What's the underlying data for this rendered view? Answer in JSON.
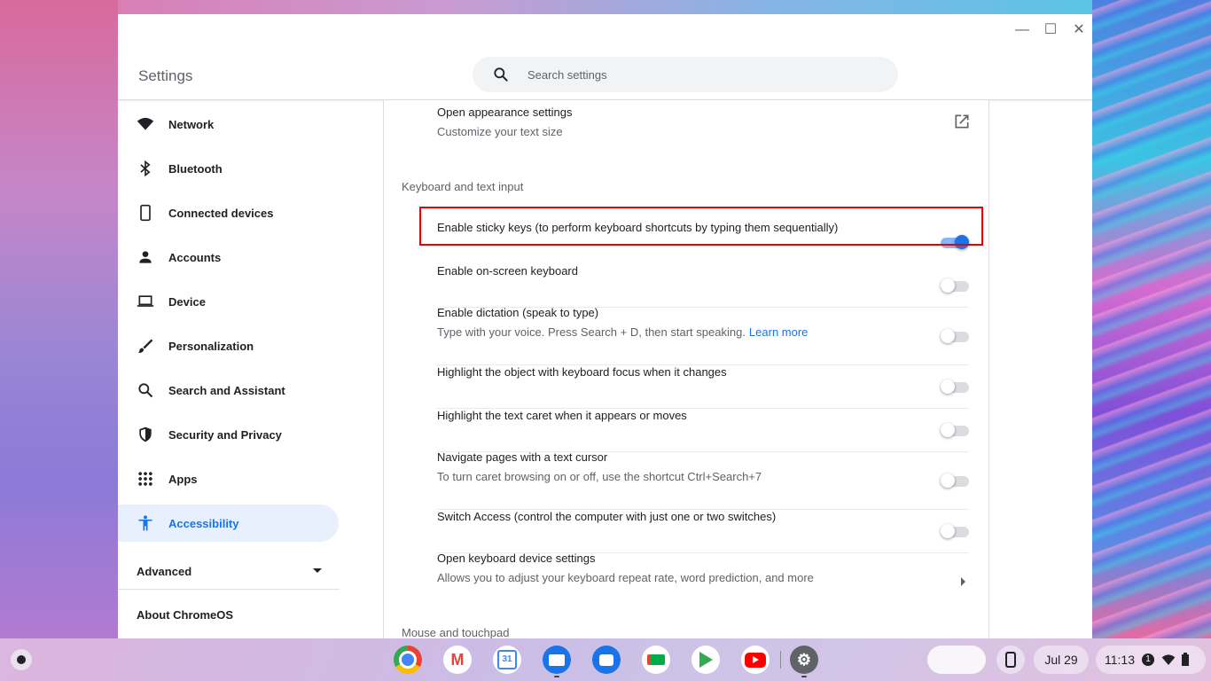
{
  "window": {
    "app_title": "Settings",
    "controls": {
      "minimize": "—",
      "maximize": "☐",
      "close": "✕"
    }
  },
  "search": {
    "placeholder": "Search settings"
  },
  "sidebar": {
    "items": [
      {
        "label": "Network",
        "icon": "wifi-icon"
      },
      {
        "label": "Bluetooth",
        "icon": "bluetooth-icon"
      },
      {
        "label": "Connected devices",
        "icon": "phone-icon"
      },
      {
        "label": "Accounts",
        "icon": "person-icon"
      },
      {
        "label": "Device",
        "icon": "laptop-icon"
      },
      {
        "label": "Personalization",
        "icon": "brush-icon"
      },
      {
        "label": "Search and Assistant",
        "icon": "search-icon"
      },
      {
        "label": "Security and Privacy",
        "icon": "shield-icon"
      },
      {
        "label": "Apps",
        "icon": "apps-grid-icon"
      },
      {
        "label": "Accessibility",
        "icon": "accessibility-icon",
        "active": true
      }
    ],
    "advanced_label": "Advanced",
    "about_label": "About ChromeOS"
  },
  "content": {
    "appearance": {
      "title": "Open appearance settings",
      "subtitle": "Customize your text size"
    },
    "keyboard_section_title": "Keyboard and text input",
    "keyboard_rows": [
      {
        "title": "Enable sticky keys (to perform keyboard shortcuts by typing them sequentially)",
        "subtitle": "",
        "enabled": true
      },
      {
        "title": "Enable on-screen keyboard",
        "subtitle": "",
        "enabled": false
      },
      {
        "title": "Enable dictation (speak to type)",
        "subtitle": "Type with your voice. Press Search + D, then start speaking.",
        "link": "Learn more",
        "enabled": false
      },
      {
        "title": "Highlight the object with keyboard focus when it changes",
        "subtitle": "",
        "enabled": false
      },
      {
        "title": "Highlight the text caret when it appears or moves",
        "subtitle": "",
        "enabled": false
      },
      {
        "title": "Navigate pages with a text cursor",
        "subtitle": "To turn caret browsing on or off, use the shortcut Ctrl+Search+7",
        "enabled": false
      },
      {
        "title": "Switch Access (control the computer with just one or two switches)",
        "subtitle": "",
        "enabled": false
      }
    ],
    "keyboard_device": {
      "title": "Open keyboard device settings",
      "subtitle": "Allows you to adjust your keyboard repeat rate, word prediction, and more"
    },
    "mouse_section_title": "Mouse and touchpad"
  },
  "shelf": {
    "apps": [
      "Chrome",
      "Gmail",
      "Calendar",
      "Files",
      "Messages",
      "Meet",
      "Play Store",
      "YouTube",
      "Settings"
    ],
    "calendar_day": "31",
    "date": "Jul 29",
    "time": "11:13",
    "notification_count": "1"
  },
  "colors": {
    "accent": "#1a73e8",
    "highlight_box": "#e00000"
  }
}
